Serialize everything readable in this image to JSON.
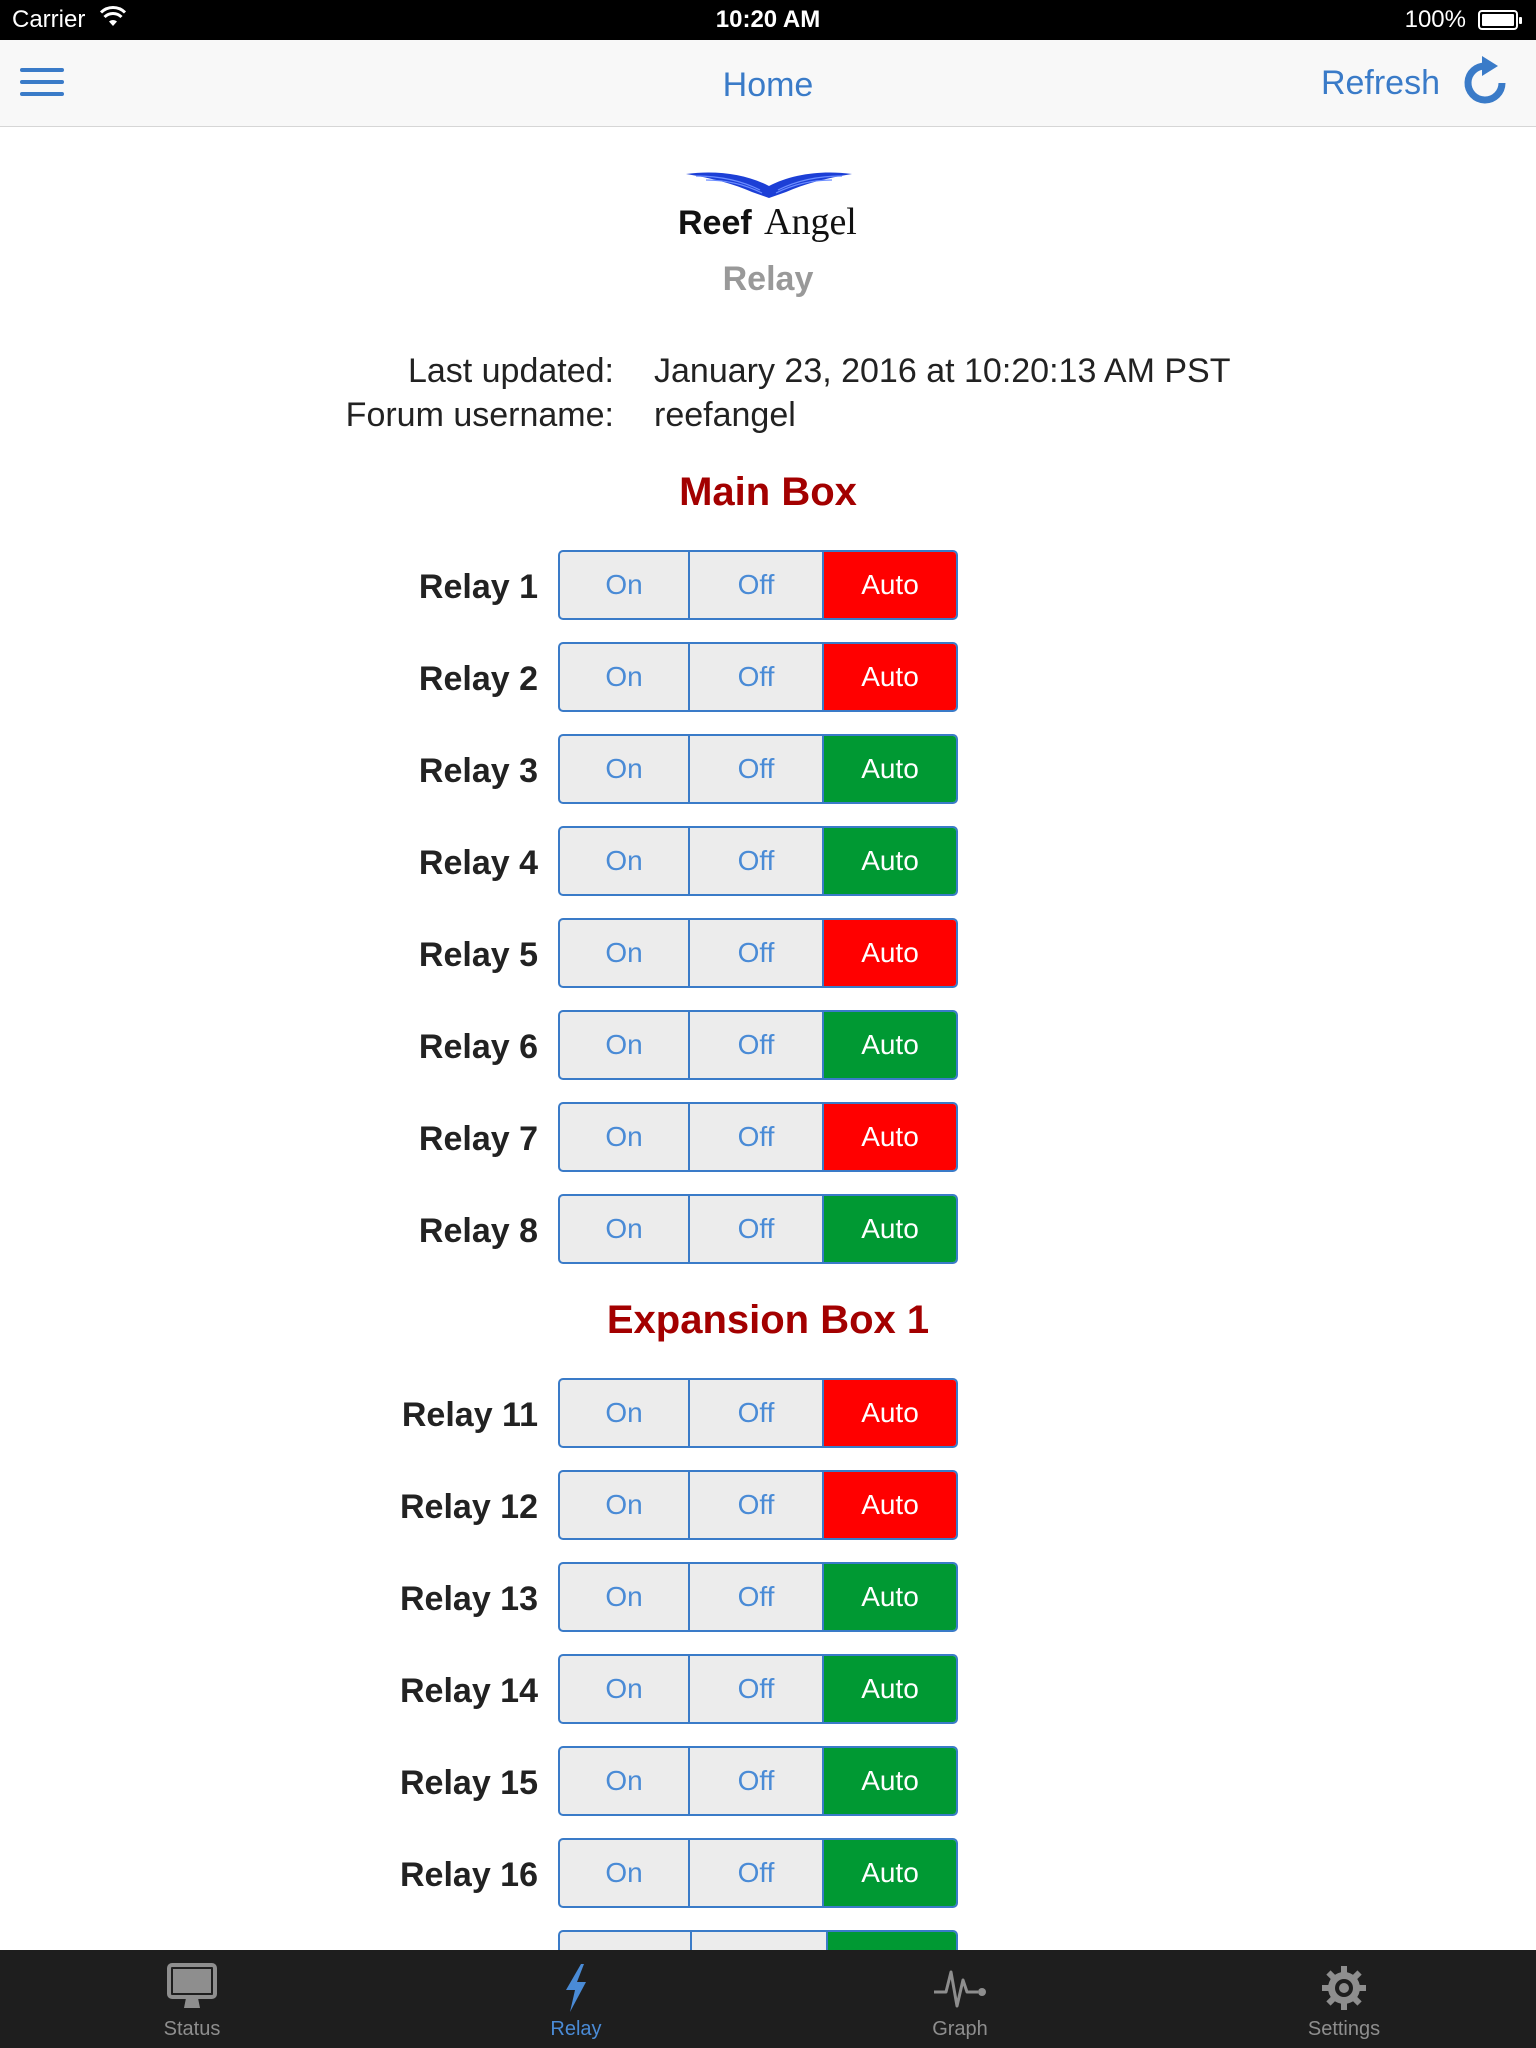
{
  "status_bar": {
    "carrier": "Carrier",
    "time": "10:20 AM",
    "battery": "100%"
  },
  "nav": {
    "title": "Home",
    "refresh_label": "Refresh",
    "menu_icon": "hamburger-menu-icon",
    "refresh_icon": "refresh-icon"
  },
  "logo": {
    "text_bold": "Reef",
    "text_serif": "Angel"
  },
  "page": {
    "subtitle": "Relay"
  },
  "info": {
    "last_updated_label": "Last updated:",
    "last_updated_value": "January 23, 2016 at 10:20:13 AM PST",
    "username_label": "Forum username:",
    "username_value": "reefangel"
  },
  "buttons": {
    "on": "On",
    "off": "Off",
    "auto": "Auto"
  },
  "sections": [
    {
      "title": "Main Box",
      "relays": [
        {
          "label": "Relay 1",
          "state": "off"
        },
        {
          "label": "Relay 2",
          "state": "off"
        },
        {
          "label": "Relay 3",
          "state": "on"
        },
        {
          "label": "Relay 4",
          "state": "on"
        },
        {
          "label": "Relay 5",
          "state": "off"
        },
        {
          "label": "Relay 6",
          "state": "on"
        },
        {
          "label": "Relay 7",
          "state": "off"
        },
        {
          "label": "Relay 8",
          "state": "on"
        }
      ]
    },
    {
      "title": "Expansion Box 1",
      "relays": [
        {
          "label": "Relay 11",
          "state": "off"
        },
        {
          "label": "Relay 12",
          "state": "off"
        },
        {
          "label": "Relay 13",
          "state": "on"
        },
        {
          "label": "Relay 14",
          "state": "on"
        },
        {
          "label": "Relay 15",
          "state": "on"
        },
        {
          "label": "Relay 16",
          "state": "on"
        }
      ]
    }
  ],
  "colors": {
    "accent": "#3a7bc8",
    "section_title": "#a30000",
    "auto_off": "#ff0000",
    "auto_on": "#009933"
  },
  "tabs": [
    {
      "label": "Status",
      "icon": "monitor-icon",
      "active": false
    },
    {
      "label": "Relay",
      "icon": "lightning-bolt-icon",
      "active": true
    },
    {
      "label": "Graph",
      "icon": "pulse-graph-icon",
      "active": false
    },
    {
      "label": "Settings",
      "icon": "gear-icon",
      "active": false
    }
  ]
}
